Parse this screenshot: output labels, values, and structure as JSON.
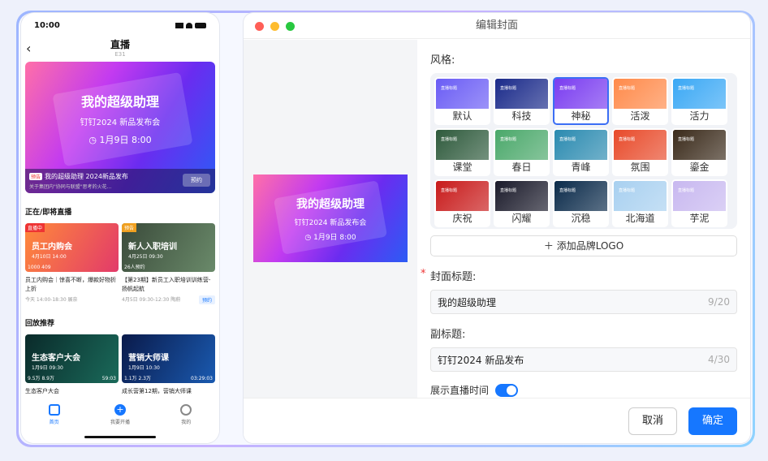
{
  "phone": {
    "time": "10:00",
    "nav_title": "直播",
    "nav_sub": "Ε31",
    "hero": {
      "title": "我的超级助理",
      "subtitle": "钉钉2024 新品发布会",
      "time": "1月9日 8:00",
      "tag": "预告",
      "line1": "我的超级助理 2024新品发布",
      "line2": "关于集团内\"协同与联盟\"思考的火花...",
      "button": "预约"
    },
    "section_live": "正在/即将直播",
    "live_items": [
      {
        "tag": "直播中",
        "title": "员工内购会",
        "date": "4月10日 14:00",
        "stats": "1000  409",
        "desc": "员工内购会｜惊喜不断，爆款好物折上折",
        "meta": "今天 14:00-18:30 展奈"
      },
      {
        "tag": "预告",
        "title": "新人入职培训",
        "date": "4月25日 09:30",
        "stats": "26人预约",
        "desc": "【第23期】新员工入职培训训练营-扬帆起航",
        "meta": "4月5日 09:30-12:30 陶蔚",
        "button": "预约"
      }
    ],
    "section_replay": "回放推荐",
    "replay_items": [
      {
        "title": "生态客户大会",
        "date": "1月9日 09:30",
        "stats": "9.5万  8.9万",
        "duration": "59:03",
        "desc": "生态客户大会"
      },
      {
        "title": "营销大师课",
        "date": "1月9日 10:30",
        "stats": "1.1万  2.3万",
        "duration": "03:29:03",
        "desc": "成长营第12期，营销大师课"
      }
    ],
    "tabs": [
      {
        "label": "首页"
      },
      {
        "label": "我要开播"
      },
      {
        "label": "我的"
      }
    ]
  },
  "window": {
    "title": "编辑封面",
    "preview": {
      "title": "我的超级助理",
      "subtitle": "钉钉2024 新品发布会",
      "time": "1月9日 8:00"
    },
    "style_label": "风格:",
    "styles": [
      {
        "name": "默认",
        "color": "#6a5cf5"
      },
      {
        "name": "科技",
        "color": "#1a2a8a"
      },
      {
        "name": "神秘",
        "color": "#7a3cf0"
      },
      {
        "name": "活泼",
        "color": "#ff8a4a"
      },
      {
        "name": "活力",
        "color": "#3aa8f5"
      },
      {
        "name": "课堂",
        "color": "#2e5a3c"
      },
      {
        "name": "春日",
        "color": "#4aa86a"
      },
      {
        "name": "青峰",
        "color": "#2a8ab0"
      },
      {
        "name": "氛围",
        "color": "#e84a2a"
      },
      {
        "name": "鎏金",
        "color": "#3a2a1a"
      },
      {
        "name": "庆祝",
        "color": "#c81a1a"
      },
      {
        "name": "闪耀",
        "color": "#1a1a2a"
      },
      {
        "name": "沉稳",
        "color": "#0a2a4a"
      },
      {
        "name": "北海道",
        "color": "#a8d0f0"
      },
      {
        "name": "芋泥",
        "color": "#c8b8f0"
      }
    ],
    "style_card_text": "直播标题",
    "add_logo": "添加品牌LOGO",
    "cover_title_label": "封面标题:",
    "cover_title_value": "我的超级助理",
    "cover_title_count": "9/20",
    "subtitle_label": "副标题:",
    "subtitle_value": "钉钉2024 新品发布",
    "subtitle_count": "4/30",
    "show_time_label": "展示直播时间",
    "cancel": "取消",
    "ok": "确定"
  }
}
